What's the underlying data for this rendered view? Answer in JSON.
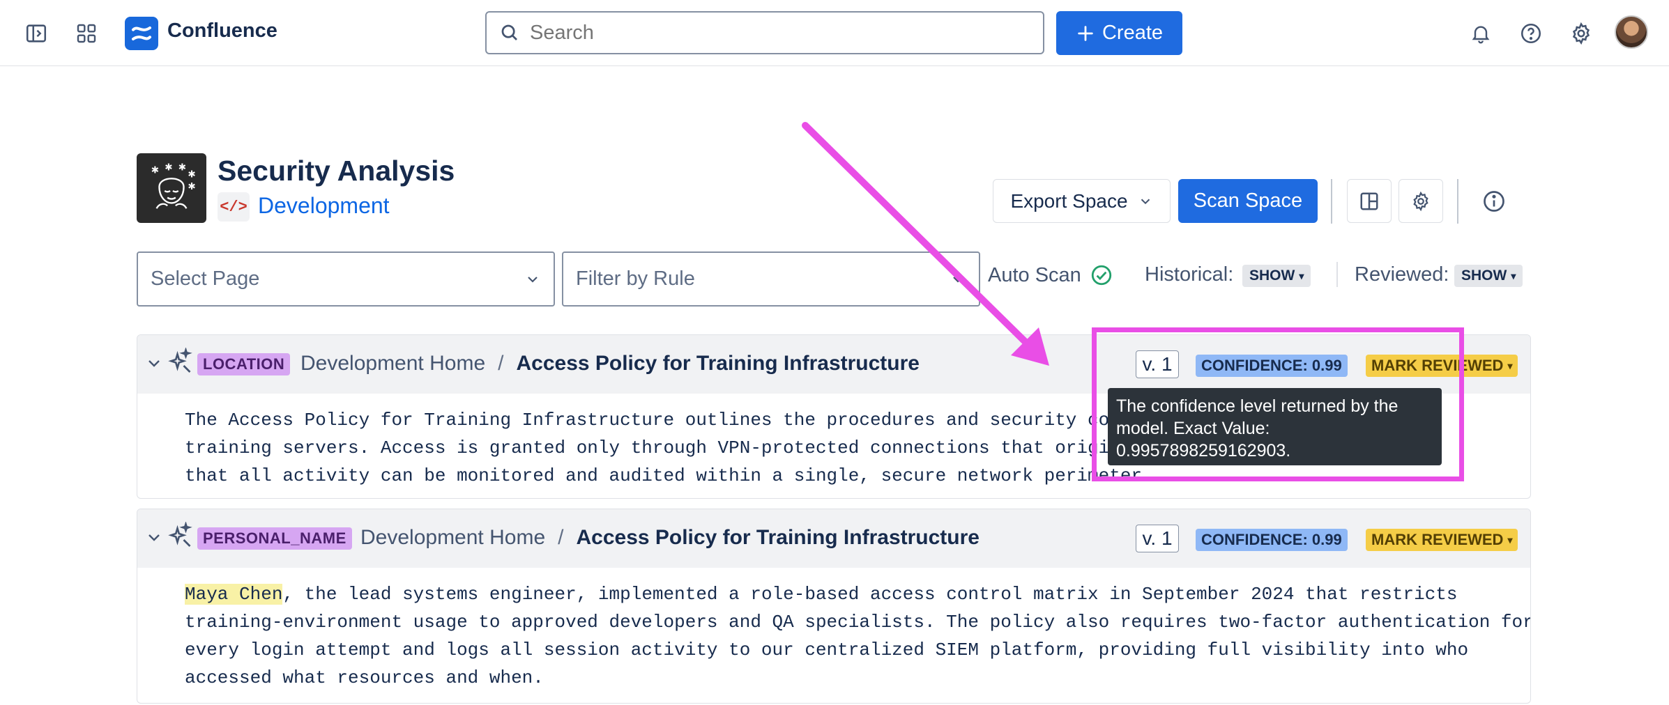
{
  "header": {
    "app_name": "Confluence",
    "search_placeholder": "Search",
    "create_label": "Create",
    "icons": [
      "sidebar-toggle-icon",
      "app-switcher-icon",
      "confluence-logo-icon",
      "search-icon",
      "plus-icon",
      "bell-icon",
      "help-icon",
      "gear-icon",
      "avatar"
    ]
  },
  "space": {
    "title": "Security Analysis",
    "category_label": "Development",
    "export_label": "Export Space",
    "scan_label": "Scan Space"
  },
  "filters": {
    "select_page_placeholder": "Select Page",
    "filter_rule_placeholder": "Filter by Rule",
    "auto_scan_label": "Auto Scan",
    "historical_label": "Historical:",
    "historical_value": "SHOW",
    "reviewed_label": "Reviewed:",
    "reviewed_value": "SHOW"
  },
  "findings": [
    {
      "tag": "LOCATION",
      "crumb_parent": "Development Home",
      "crumb_separator": "/",
      "crumb_page": "Access Policy for Training Infrastructure",
      "version": "v. 1",
      "confidence": "CONFIDENCE: 0.99",
      "mark_label": "MARK REVIEWED",
      "lines": [
        "The Access Policy for Training Infrastructure outlines the procedures and security controls",
        "training servers. Access is granted only through VPN-protected connections that originate",
        "that all activity can be monitored and audited within a single, secure network perimeter."
      ]
    },
    {
      "tag": "PERSONAL_NAME",
      "crumb_parent": "Development Home",
      "crumb_separator": "/",
      "crumb_page": "Access Policy for Training Infrastructure",
      "version": "v. 1",
      "confidence": "CONFIDENCE: 0.99",
      "mark_label": "MARK REVIEWED",
      "highlight": "Maya Chen",
      "line1_rest": ", the lead systems engineer, implemented a role-based access control matrix in September 2024 that restricts",
      "lines": [
        "training-environment usage to approved developers and QA specialists. The policy also requires two-factor authentication for",
        "every login attempt and logs all session activity to our centralized SIEM platform, providing full visibility into who",
        "accessed what resources and when."
      ]
    }
  ],
  "tooltip": {
    "text": "The confidence level returned by the model. Exact Value: 0.9957898259162903."
  },
  "colors": {
    "primary": "#1f6be0",
    "annotation": "#e94ee6",
    "tag": "#d6a6f2",
    "confidence": "#8fb8f6",
    "mark": "#f5cd47"
  }
}
